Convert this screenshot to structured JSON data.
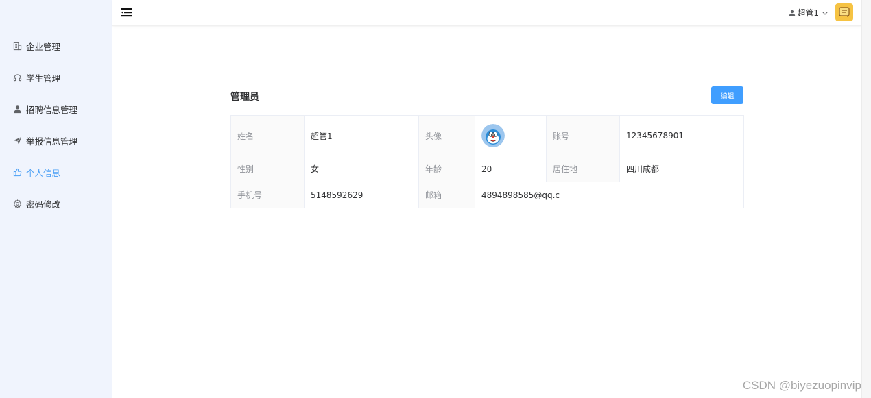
{
  "sidebar": {
    "items": [
      {
        "label": "企业管理",
        "icon": "building-icon"
      },
      {
        "label": "学生管理",
        "icon": "headset-icon"
      },
      {
        "label": "招聘信息管理",
        "icon": "user-icon"
      },
      {
        "label": "举报信息管理",
        "icon": "paper-plane-icon"
      },
      {
        "label": "个人信息",
        "icon": "thumb-icon",
        "active": true
      },
      {
        "label": "密码修改",
        "icon": "gear-icon"
      }
    ]
  },
  "header": {
    "username": "超管1",
    "menu_icon": "hamburger-icon"
  },
  "profile": {
    "title": "管理员",
    "edit_label": "编辑",
    "rows": [
      [
        {
          "label": "姓名",
          "value": "超管1"
        },
        {
          "label": "头像",
          "value": ""
        },
        {
          "label": "账号",
          "value": "12345678901"
        }
      ],
      [
        {
          "label": "性别",
          "value": "女"
        },
        {
          "label": "年龄",
          "value": "20"
        },
        {
          "label": "居住地",
          "value": "四川成都"
        }
      ],
      [
        {
          "label": "手机号",
          "value": "5148592629"
        },
        {
          "label": "邮箱",
          "value": "4894898585@qq.c"
        }
      ]
    ]
  },
  "watermark": "CSDN @biyezuopinvip",
  "colors": {
    "accent": "#409eff",
    "active_menu": "#4a9ff5",
    "sidebar_bg": "#f0f4fd"
  }
}
